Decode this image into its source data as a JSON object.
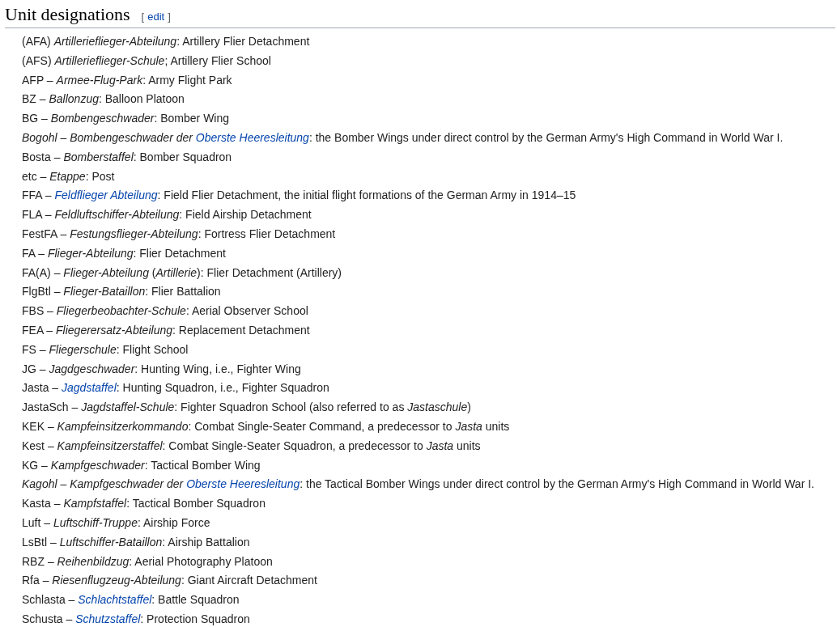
{
  "section": {
    "title": "Unit designations",
    "edit": {
      "open": "[",
      "label": "edit",
      "close": "]"
    }
  },
  "items": [
    [
      {
        "kind": "text",
        "text": "(AFA) *Artillerieflieger-Abteilung*: Artillery Flier Detachment"
      }
    ],
    [
      {
        "kind": "text",
        "text": "(AFS) *Artillerieflieger-Schule*; Artillery Flier School"
      }
    ],
    [
      {
        "kind": "text",
        "text": "AFP – *Armee-Flug-Park*: Army Flight Park"
      }
    ],
    [
      {
        "kind": "text",
        "text": "BZ – *Ballonzug*: Balloon Platoon"
      }
    ],
    [
      {
        "kind": "text",
        "text": "BG – *Bombengeschwader*: Bomber Wing"
      }
    ],
    [
      {
        "kind": "text",
        "text": "*Bogohl* – *Bombengeschwader der* "
      },
      {
        "kind": "link",
        "text": "Oberste Heeresleitung"
      },
      {
        "kind": "text",
        "text": ": the Bomber Wings under direct control by the German Army's High Command in World War I."
      }
    ],
    [
      {
        "kind": "text",
        "text": "Bosta – *Bomberstaffel*: Bomber Squadron"
      }
    ],
    [
      {
        "kind": "text",
        "text": "etc – *Etappe*: Post"
      }
    ],
    [
      {
        "kind": "text",
        "text": "FFA – "
      },
      {
        "kind": "link",
        "text": "Feldflieger Abteilung"
      },
      {
        "kind": "text",
        "text": ": Field Flier Detachment, the initial flight formations of the German Army in 1914–15"
      }
    ],
    [
      {
        "kind": "text",
        "text": "FLA – *Feldluftschiffer-Abteilung*: Field Airship Detachment"
      }
    ],
    [
      {
        "kind": "text",
        "text": "FestFA – *Festungsflieger-Abteilung*: Fortress Flier Detachment"
      }
    ],
    [
      {
        "kind": "text",
        "text": "FA – *Flieger-Abteilung*: Flier Detachment"
      }
    ],
    [
      {
        "kind": "text",
        "text": "FA(A) – *Flieger-Abteilung* (*Artillerie*): Flier Detachment (Artillery)"
      }
    ],
    [
      {
        "kind": "text",
        "text": "FlgBtl – *Flieger-Bataillon*: Flier Battalion"
      }
    ],
    [
      {
        "kind": "text",
        "text": "FBS – *Fliegerbeobachter-Schule*: Aerial Observer School"
      }
    ],
    [
      {
        "kind": "text",
        "text": "FEA – *Fliegerersatz-Abteilung*: Replacement Detachment"
      }
    ],
    [
      {
        "kind": "text",
        "text": "FS – *Fliegerschule*: Flight School"
      }
    ],
    [
      {
        "kind": "text",
        "text": "JG – *Jagdgeschwader*: Hunting Wing, i.e., Fighter Wing"
      }
    ],
    [
      {
        "kind": "text",
        "text": "Jasta – "
      },
      {
        "kind": "link",
        "text": "Jagdstaffel"
      },
      {
        "kind": "text",
        "text": ": Hunting Squadron, i.e., Fighter Squadron"
      }
    ],
    [
      {
        "kind": "text",
        "text": "JastaSch – *Jagdstaffel-Schule*: Fighter Squadron School (also referred to as *Jastaschule*)"
      }
    ],
    [
      {
        "kind": "text",
        "text": "KEK – *Kampfeinsitzerkommando*: Combat Single-Seater Command, a predecessor to *Jasta* units"
      }
    ],
    [
      {
        "kind": "text",
        "text": "Kest – *Kampfeinsitzerstaffel*: Combat Single-Seater Squadron, a predecessor to *Jasta* units"
      }
    ],
    [
      {
        "kind": "text",
        "text": "KG – *Kampfgeschwader*: Tactical Bomber Wing"
      }
    ],
    [
      {
        "kind": "text",
        "text": "*Kagohl* – *Kampfgeschwader der* "
      },
      {
        "kind": "link",
        "text": "Oberste Heeresleitung"
      },
      {
        "kind": "text",
        "text": ": the Tactical Bomber Wings under direct control by the German Army's High Command in World War I."
      }
    ],
    [
      {
        "kind": "text",
        "text": "Kasta – *Kampfstaffel*: Tactical Bomber Squadron"
      }
    ],
    [
      {
        "kind": "text",
        "text": "Luft – *Luftschiff-Truppe*: Airship Force"
      }
    ],
    [
      {
        "kind": "text",
        "text": "LsBtl – *Luftschiffer-Bataillon*: Airship Battalion"
      }
    ],
    [
      {
        "kind": "text",
        "text": "RBZ – *Reihenbildzug*: Aerial Photography Platoon"
      }
    ],
    [
      {
        "kind": "text",
        "text": "Rfa – *Riesenflugzeug-Abteilung*: Giant Aircraft Detachment"
      }
    ],
    [
      {
        "kind": "text",
        "text": "Schlasta – "
      },
      {
        "kind": "link",
        "text": "Schlachtstaffel"
      },
      {
        "kind": "text",
        "text": ": Battle Squadron"
      }
    ],
    [
      {
        "kind": "text",
        "text": "Schusta – "
      },
      {
        "kind": "link",
        "text": "Schutzstaffel"
      },
      {
        "kind": "text",
        "text": ": Protection Squadron"
      }
    ]
  ]
}
